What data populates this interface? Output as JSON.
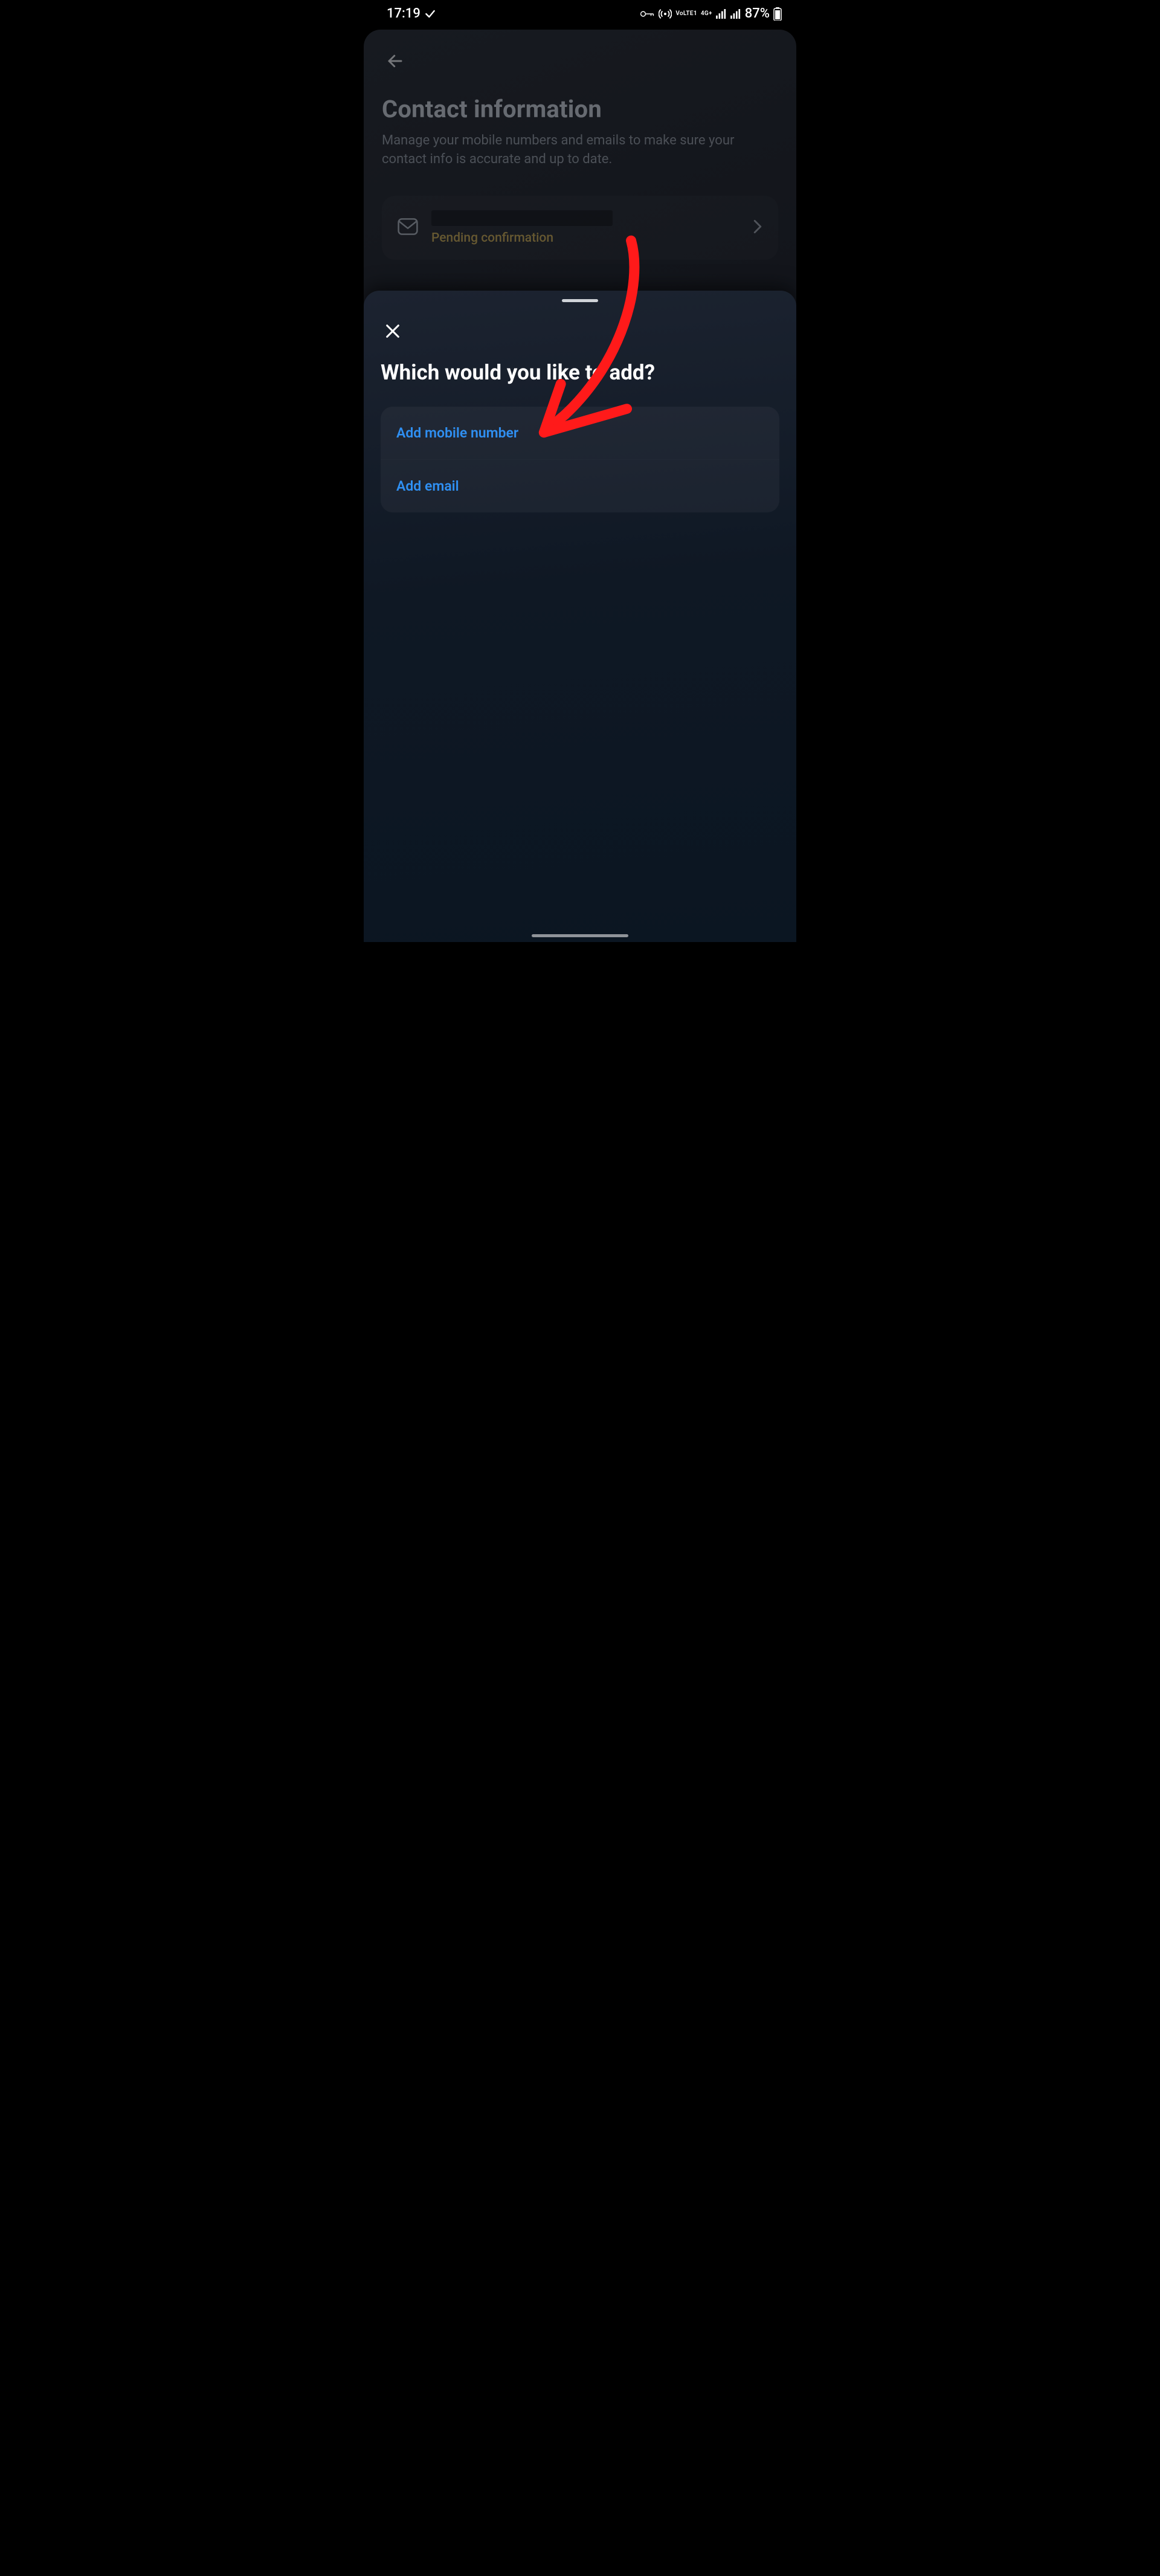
{
  "status": {
    "time": "17:19",
    "vpn_glyph": "key-icon",
    "hotspot_glyph": "hotspot-icon",
    "network_line1": "VoLTE1",
    "network_line2": "4G+",
    "battery_pct": "87%"
  },
  "page": {
    "title": "Contact information",
    "subtitle": "Manage your mobile numbers and emails to make sure your contact info is accurate and up to date.",
    "item_status": "Pending confirmation"
  },
  "sheet": {
    "title": "Which would you like to add?",
    "option_mobile": "Add mobile number",
    "option_email": "Add email"
  },
  "annotation": {
    "target": "Add mobile number"
  }
}
